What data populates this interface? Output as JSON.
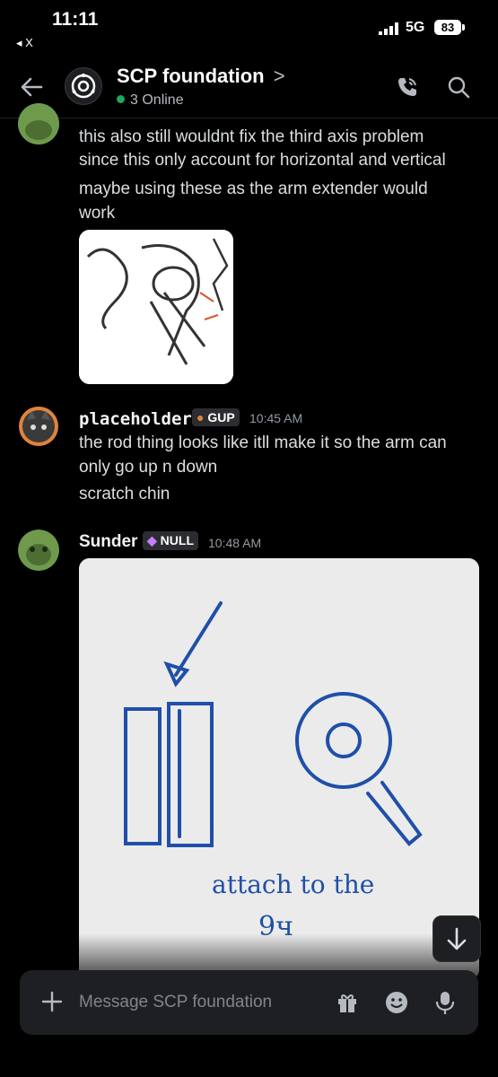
{
  "status_bar": {
    "time": "11:11",
    "back_app": "◂ X",
    "network": "5G",
    "battery": "83"
  },
  "header": {
    "title": "SCP foundation",
    "chevron": ">",
    "online": "3 Online"
  },
  "messages": [
    {
      "lines": [
        "this also still wouldnt fix the third axis problem",
        "since this only account for horizontal and vertical",
        "maybe using these as the arm extender would",
        "work"
      ]
    },
    {
      "author": "placeholder",
      "badge": "GUP",
      "time": "10:45 AM",
      "lines": [
        "the rod thing looks like itll make it so the arm can",
        "only go up n down",
        "scratch chin"
      ]
    },
    {
      "author": "Sunder",
      "badge": "NULL",
      "time": "10:48 AM",
      "image_text": {
        "line1": "attach to the",
        "line2": "9ч"
      }
    }
  ],
  "composer": {
    "placeholder": "Message SCP foundation"
  },
  "icons": {
    "back": "back-arrow-icon",
    "server": "scp-logo-icon",
    "call": "phone-icon",
    "search": "search-icon",
    "plus": "plus-icon",
    "gift": "gift-icon",
    "emoji": "emoji-icon",
    "mic": "microphone-icon",
    "jump": "arrow-down-icon"
  },
  "colors": {
    "online": "#23a55a",
    "sketch_ink": "#1f4fa8",
    "badge_gup": "#e0833a",
    "badge_null": "#c77dff"
  }
}
